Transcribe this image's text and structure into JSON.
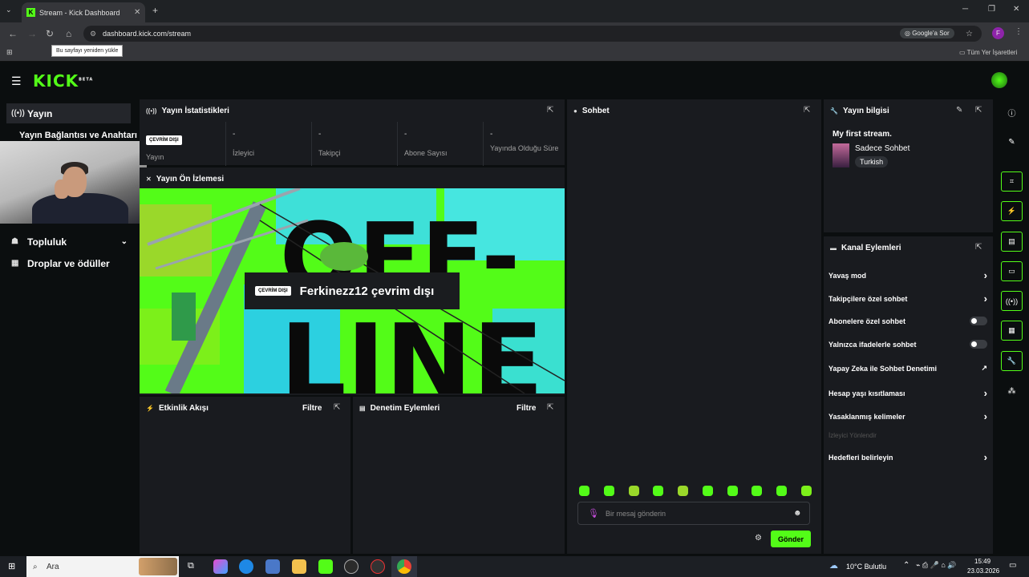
{
  "browser": {
    "tab_title": "Stream - Kick Dashboard",
    "tab_favicon": "K",
    "url": "dashboard.kick.com/stream",
    "google_label": "Google'a Sor",
    "profile_initial": "F",
    "bookmarks_label": "Tüm Yer İşaretleri",
    "tooltip": "Bu sayfayı yeniden yükle"
  },
  "brand": {
    "logo": "KICK",
    "beta": "BETA",
    "accent": "#53fc18"
  },
  "sidebar": {
    "items": [
      {
        "label": "Yayın",
        "icon": "broadcast-icon"
      },
      {
        "label": "Yayın Bağlantısı ve Anahtarı"
      },
      {
        "label": "Topluluk",
        "icon": "community-icon"
      },
      {
        "label": "Droplar ve ödüller",
        "icon": "gift-icon"
      }
    ]
  },
  "stats": {
    "title": "Yayın İstatistikleri",
    "offline_pill": "ÇEVRİM DIŞI",
    "items": [
      {
        "value": "",
        "label": "Yayın"
      },
      {
        "value": "-",
        "label": "İzleyici"
      },
      {
        "value": "-",
        "label": "Takipçi"
      },
      {
        "value": "-",
        "label": "Abone Sayısı"
      },
      {
        "value": "-",
        "label": "Yayında Olduğu Süre"
      }
    ]
  },
  "preview": {
    "title": "Yayın Ön İzlemesi",
    "pill": "ÇEVRİM DIŞI",
    "message": "Ferkinezz12 çevrim dışı",
    "art_text_top": "OFF-",
    "art_text_bottom": "LINE"
  },
  "activity": {
    "title": "Etkinlik Akışı",
    "filter": "Filtre"
  },
  "moderation": {
    "title": "Denetim Eylemleri",
    "filter": "Filtre"
  },
  "chat": {
    "title": "Sohbet",
    "placeholder": "Bir mesaj gönderin",
    "send": "Gönder"
  },
  "stream_info": {
    "title": "Yayın bilgisi",
    "stream_title": "My first stream.",
    "category": "Sadece Sohbet",
    "language": "Turkish"
  },
  "channel_actions": {
    "title": "Kanal Eylemleri",
    "items": [
      {
        "label": "Yavaş mod",
        "control": "chevron"
      },
      {
        "label": "Takipçilere özel sohbet",
        "control": "chevron"
      },
      {
        "label": "Abonelere özel sohbet",
        "control": "toggle"
      },
      {
        "label": "Yalnızca ifadelerle sohbet",
        "control": "toggle"
      },
      {
        "label": "Yapay Zeka ile Sohbet Denetimi",
        "control": "external"
      },
      {
        "label": "Hesap yaşı kısıtlaması",
        "control": "chevron"
      },
      {
        "label": "Yasaklanmış kelimeler",
        "control": "chevron"
      },
      {
        "label": "İzleyici Yönlendir",
        "control": "disabled"
      },
      {
        "label": "Hedefleri belirleyin",
        "control": "chevron"
      }
    ]
  },
  "taskbar": {
    "search": "Ara",
    "weather": "10°C  Bulutlu",
    "time": "15:49",
    "date": "23.03.2026"
  }
}
